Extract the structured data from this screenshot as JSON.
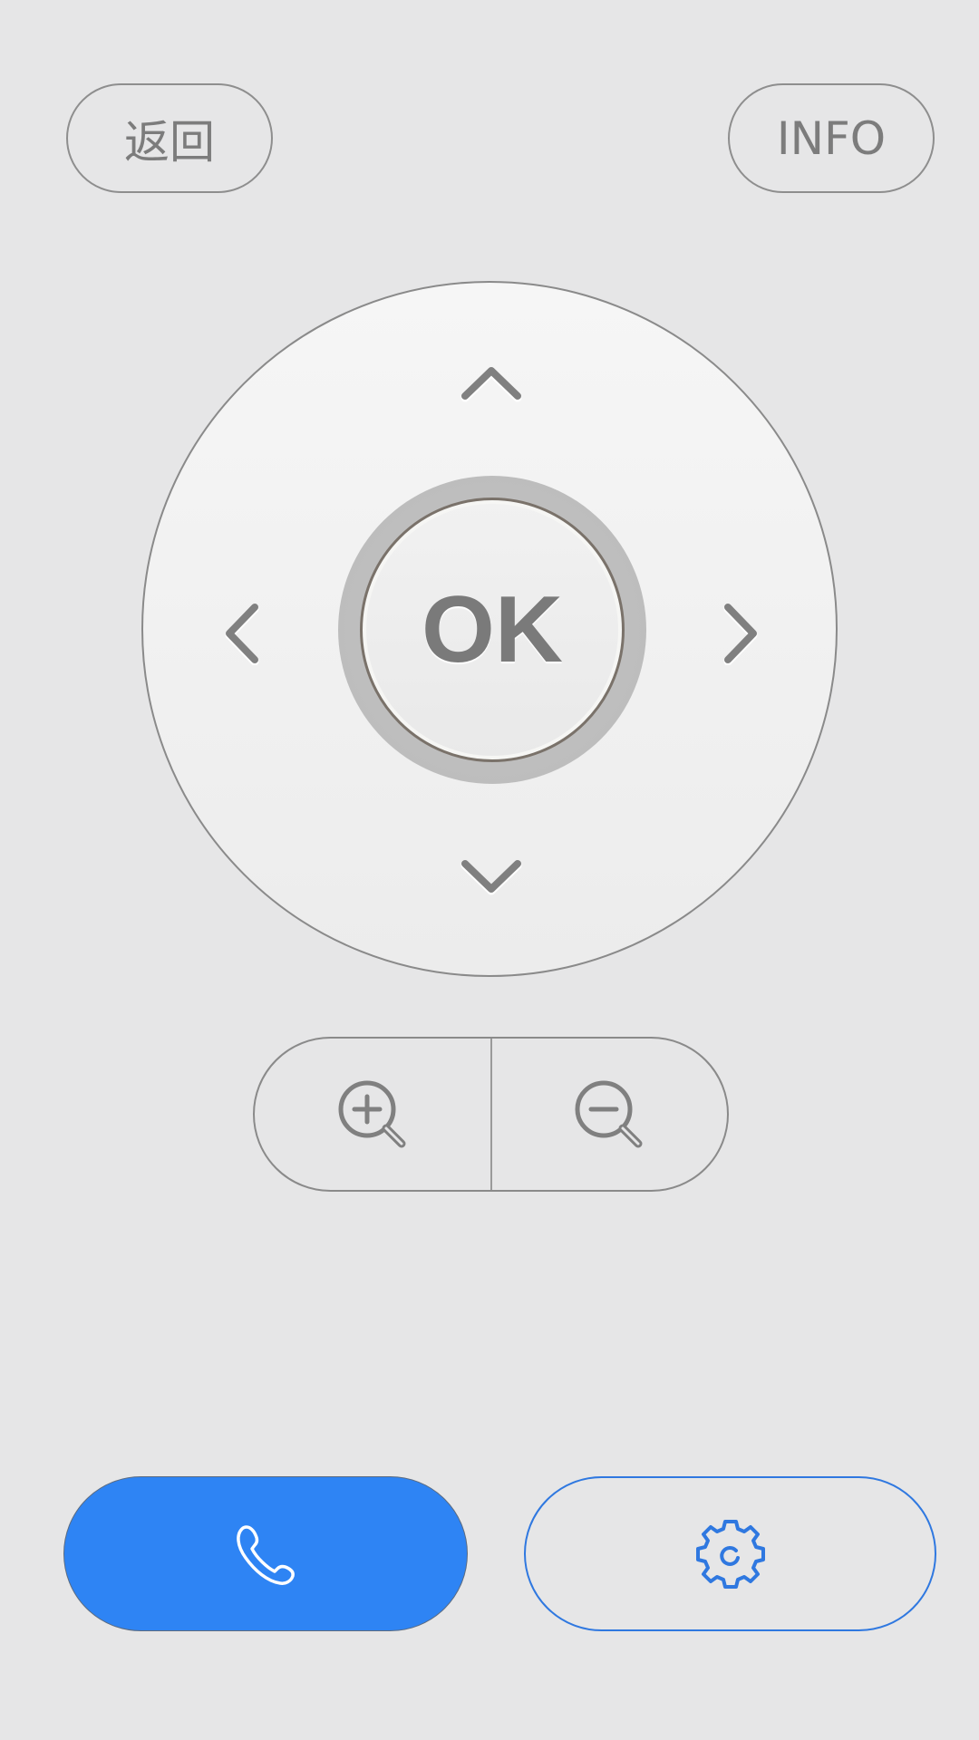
{
  "top_buttons": {
    "back_label": "返回",
    "info_label": "INFO"
  },
  "dpad": {
    "ok_label": "OK",
    "up_icon": "chevron-up-icon",
    "down_icon": "chevron-down-icon",
    "left_icon": "chevron-left-icon",
    "right_icon": "chevron-right-icon"
  },
  "zoom": {
    "in_icon": "zoom-in-icon",
    "out_icon": "zoom-out-icon"
  },
  "bottom_buttons": {
    "call_icon": "phone-icon",
    "settings_icon": "gear-icon"
  },
  "colors": {
    "background": "#e6e6e7",
    "accent_blue": "#2e84f4",
    "icon_gray": "#808080"
  }
}
